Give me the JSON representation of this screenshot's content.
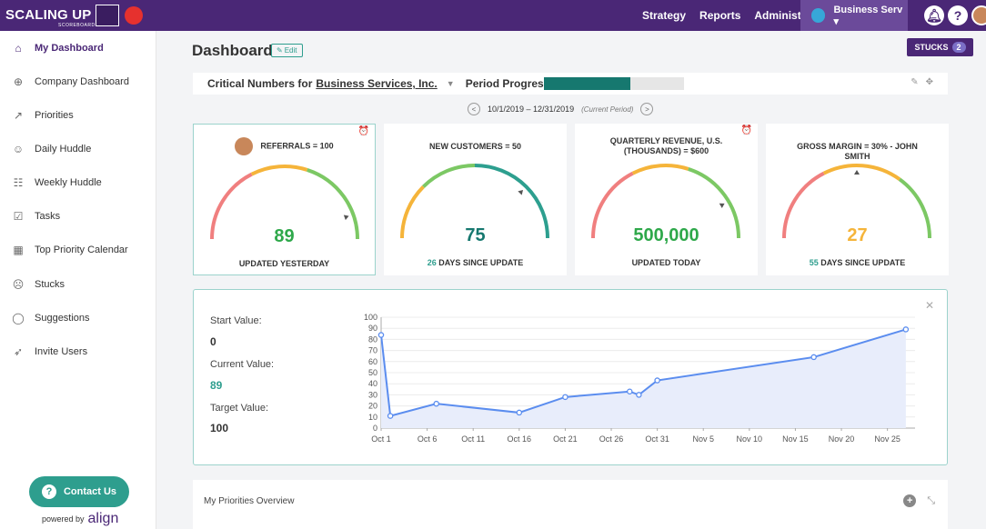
{
  "topbar": {
    "logo_text": "SCALING UP",
    "logo_sub": "SCOREBOARD",
    "nav": [
      "Strategy",
      "Reports",
      "Administration"
    ],
    "business": "Business Serv ▾"
  },
  "sidebar": {
    "items": [
      {
        "label": "My Dashboard",
        "icon": "home-icon",
        "glyph": "⌂",
        "active": true
      },
      {
        "label": "Company Dashboard",
        "icon": "globe-icon",
        "glyph": "⊕"
      },
      {
        "label": "Priorities",
        "icon": "trend-icon",
        "glyph": "↗"
      },
      {
        "label": "Daily Huddle",
        "icon": "person-icon",
        "glyph": "☺"
      },
      {
        "label": "Weekly Huddle",
        "icon": "group-icon",
        "glyph": "☷"
      },
      {
        "label": "Tasks",
        "icon": "checkbox-icon",
        "glyph": "☑"
      },
      {
        "label": "Top Priority Calendar",
        "icon": "calendar-icon",
        "glyph": "▦"
      },
      {
        "label": "Stucks",
        "icon": "frown-icon",
        "glyph": "☹"
      },
      {
        "label": "Suggestions",
        "icon": "chat-icon",
        "glyph": "◯"
      },
      {
        "label": "Invite Users",
        "icon": "send-icon",
        "glyph": "➶"
      }
    ],
    "contact": "Contact Us",
    "powered_by": "powered by",
    "powered_brand": "align"
  },
  "page": {
    "title": "Dashboard",
    "edit": "Edit",
    "stucks_label": "STUCKS",
    "stucks_count": "2"
  },
  "critical": {
    "label": "Critical Numbers for",
    "business": "Business Services, Inc.",
    "period_progress_label": "Period Progress:",
    "progress": 0.62
  },
  "period": {
    "range": "10/1/2019 – 12/31/2019",
    "note": "(Current Period)"
  },
  "cards": [
    {
      "title": "REFERRALS = 100",
      "value": "89",
      "value_color": "#2ea84a",
      "foot": "UPDATED YESTERDAY",
      "foot_num": "",
      "needle": 0.89,
      "arc": "rgyg",
      "alarm": true,
      "avatar": true
    },
    {
      "title": "NEW CUSTOMERS = 50",
      "value": "75",
      "value_color": "#16786f",
      "foot": "DAYS SINCE UPDATE",
      "foot_num": "26",
      "needle": 0.75,
      "arc": "ygt",
      "alarm": false,
      "avatar": false
    },
    {
      "title": "QUARTERLY REVENUE, U.S. (THOUSANDS) = $600",
      "value": "500,000",
      "value_color": "#2ea84a",
      "foot": "UPDATED TODAY",
      "foot_num": "",
      "needle": 0.83,
      "arc": "rgyg",
      "alarm": true,
      "avatar": false
    },
    {
      "title": "GROSS MARGIN = 30% - JOHN SMITH",
      "value": "27",
      "value_color": "#f5b43a",
      "foot": "DAYS SINCE UPDATE",
      "foot_num": "55",
      "needle": 0.5,
      "arc": "rygt",
      "alarm": false,
      "avatar": false
    }
  ],
  "detail": {
    "start_label": "Start Value:",
    "start_value": "0",
    "current_label": "Current Value:",
    "current_value": "89",
    "target_label": "Target Value:",
    "target_value": "100"
  },
  "chart_data": {
    "type": "area",
    "x_ticks": [
      "Oct 1",
      "Oct 6",
      "Oct 11",
      "Oct 16",
      "Oct 21",
      "Oct 26",
      "Oct 31",
      "Nov 5",
      "Nov 10",
      "Nov 15",
      "Nov 20",
      "Nov 25"
    ],
    "y_ticks": [
      0,
      10,
      20,
      30,
      40,
      50,
      60,
      70,
      80,
      90,
      100
    ],
    "ylim": [
      0,
      100
    ],
    "xlim": [
      0,
      58
    ],
    "x": [
      0,
      1,
      6,
      15,
      20,
      27,
      28,
      30,
      47,
      57
    ],
    "y": [
      84,
      11,
      22,
      14,
      28,
      33,
      30,
      43,
      64,
      89
    ],
    "line_color": "#5b8def",
    "fill_color": "#e8edfb",
    "xlabel": "",
    "ylabel": "",
    "grid": true
  },
  "priorities": {
    "title": "My Priorities Overview"
  },
  "colors": {
    "purple": "#4a2776",
    "teal": "#2e9e8e",
    "red": "#f07f7f",
    "yellow": "#f5b43a",
    "green": "#7cc864",
    "tealarc": "#2d9f8f"
  }
}
